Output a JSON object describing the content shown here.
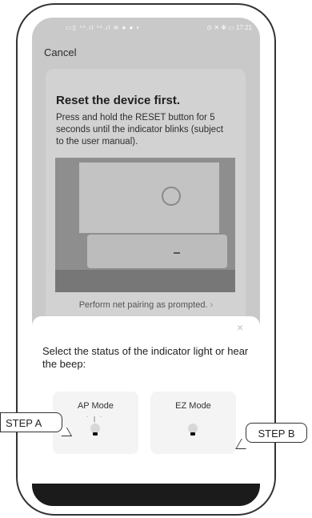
{
  "status_bar": {
    "left_icons": "▭▯ ⁴⁶.ıl ⁴⁶.ıl ≋ ● ● ▪",
    "right_icons": "⊙ ✕ ✻ ▭",
    "time": "17:21"
  },
  "header": {
    "cancel_label": "Cancel"
  },
  "card": {
    "title": "Reset the device first.",
    "body": "Press and hold the RESET button for 5 seconds until the indicator blinks (subject to the user manual).",
    "footer": "Perform net pairing as prompted."
  },
  "sheet": {
    "close_icon": "×",
    "title": "Select the status of the indicator light or hear the beep:",
    "modes": [
      {
        "label": "AP Mode",
        "icon": "blinking-bulb-icon"
      },
      {
        "label": "EZ Mode",
        "icon": "bulb-icon"
      }
    ]
  },
  "callouts": {
    "step_a": "STEP A",
    "step_b": "STEP B"
  }
}
